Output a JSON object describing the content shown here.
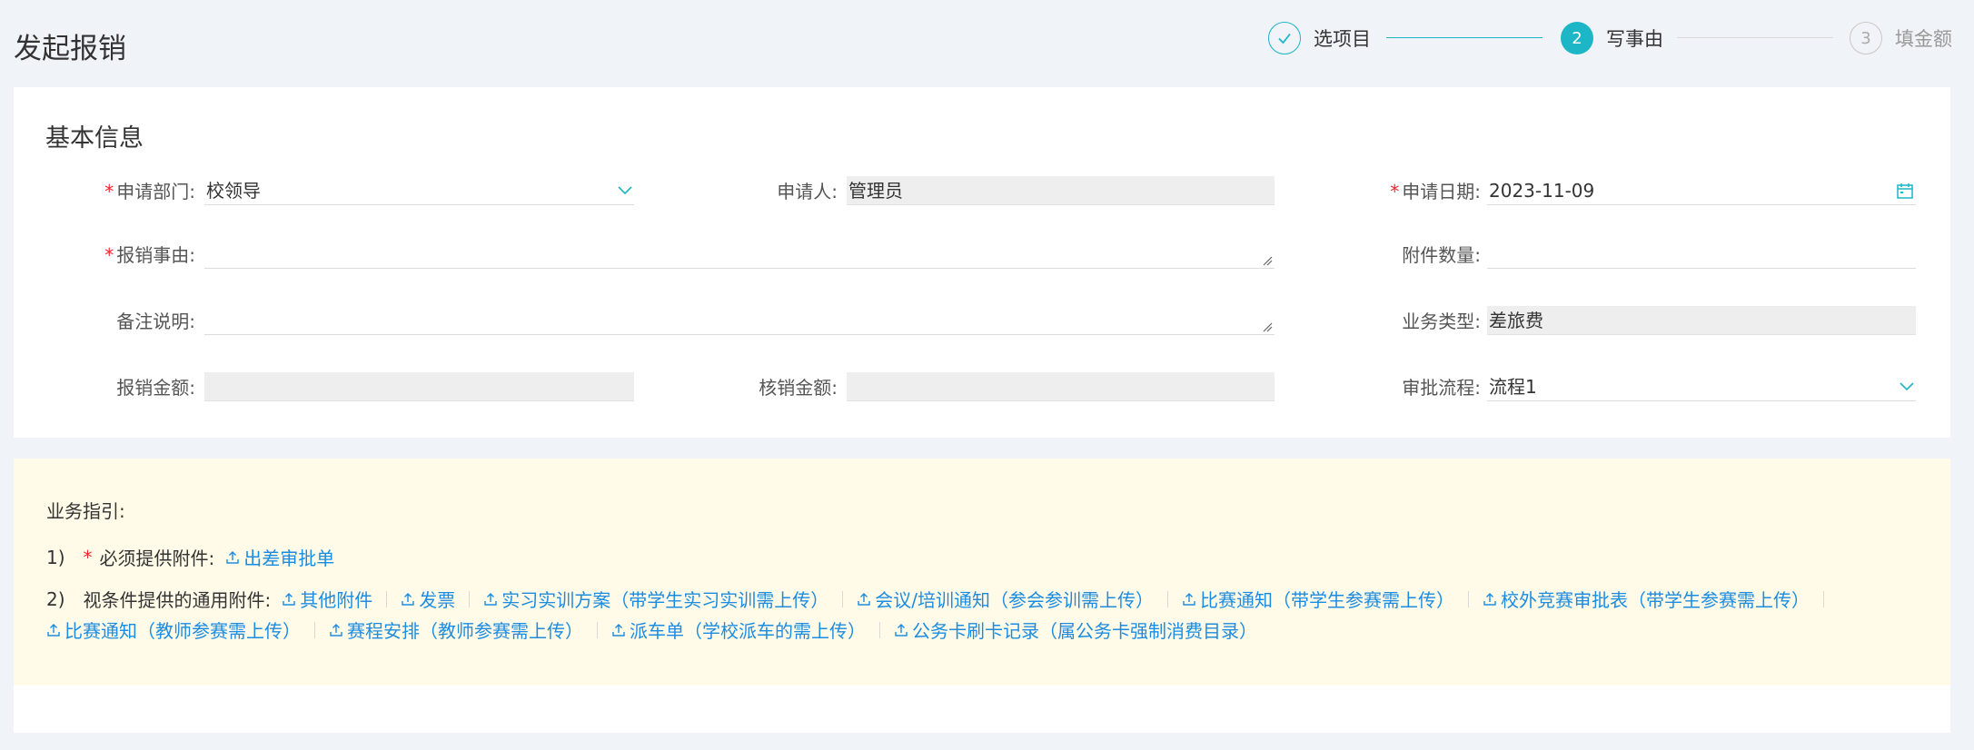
{
  "page": {
    "title": "发起报销"
  },
  "steps": [
    {
      "index": "1",
      "label": "选项目",
      "state": "done"
    },
    {
      "index": "2",
      "label": "写事由",
      "state": "active"
    },
    {
      "index": "3",
      "label": "填金额",
      "state": "todo"
    }
  ],
  "basic_info": {
    "title": "基本信息",
    "department": {
      "label": "申请部门:",
      "value": "校领导",
      "required": true,
      "icon": "chevron-down-icon"
    },
    "applicant": {
      "label": "申请人:",
      "value": "管理员"
    },
    "apply_date": {
      "label": "申请日期:",
      "value": "2023-11-09",
      "required": true,
      "icon": "calendar-icon"
    },
    "reason": {
      "label": "报销事由:",
      "value": "",
      "required": true
    },
    "attachment_count": {
      "label": "附件数量:",
      "value": ""
    },
    "remark": {
      "label": "备注说明:",
      "value": ""
    },
    "business_type": {
      "label": "业务类型:",
      "value": "差旅费"
    },
    "reimburse_amount": {
      "label": "报销金额:",
      "value": ""
    },
    "writeoff_amount": {
      "label": "核销金额:",
      "value": ""
    },
    "approval_flow": {
      "label": "审批流程:",
      "value": "流程1",
      "icon": "chevron-down-icon"
    }
  },
  "guide": {
    "title": "业务指引:",
    "line1": {
      "num": "1)",
      "required_mark": "*",
      "label": "必须提供附件:",
      "links": [
        "出差审批单"
      ]
    },
    "line2": {
      "num": "2)",
      "label": "视条件提供的通用附件:",
      "links_row1": [
        "其他附件",
        "发票",
        "实习实训方案（带学生实习实训需上传）",
        "会议/培训通知（参会参训需上传）",
        "比赛通知（带学生参赛需上传）",
        "校外竞赛审批表（带学生参赛需上传）"
      ],
      "links_row2": [
        "比赛通知（教师参赛需上传）",
        "赛程安排（教师参赛需上传）",
        "派车单（学校派车的需上传）",
        "公务卡刷卡记录（属公务卡强制消费目录）"
      ]
    }
  },
  "colors": {
    "accent": "#1cb6c7",
    "link": "#1d8ce0",
    "required": "#f5222d",
    "guide_bg": "#fffbe8",
    "page_bg": "#f0f3f8"
  }
}
